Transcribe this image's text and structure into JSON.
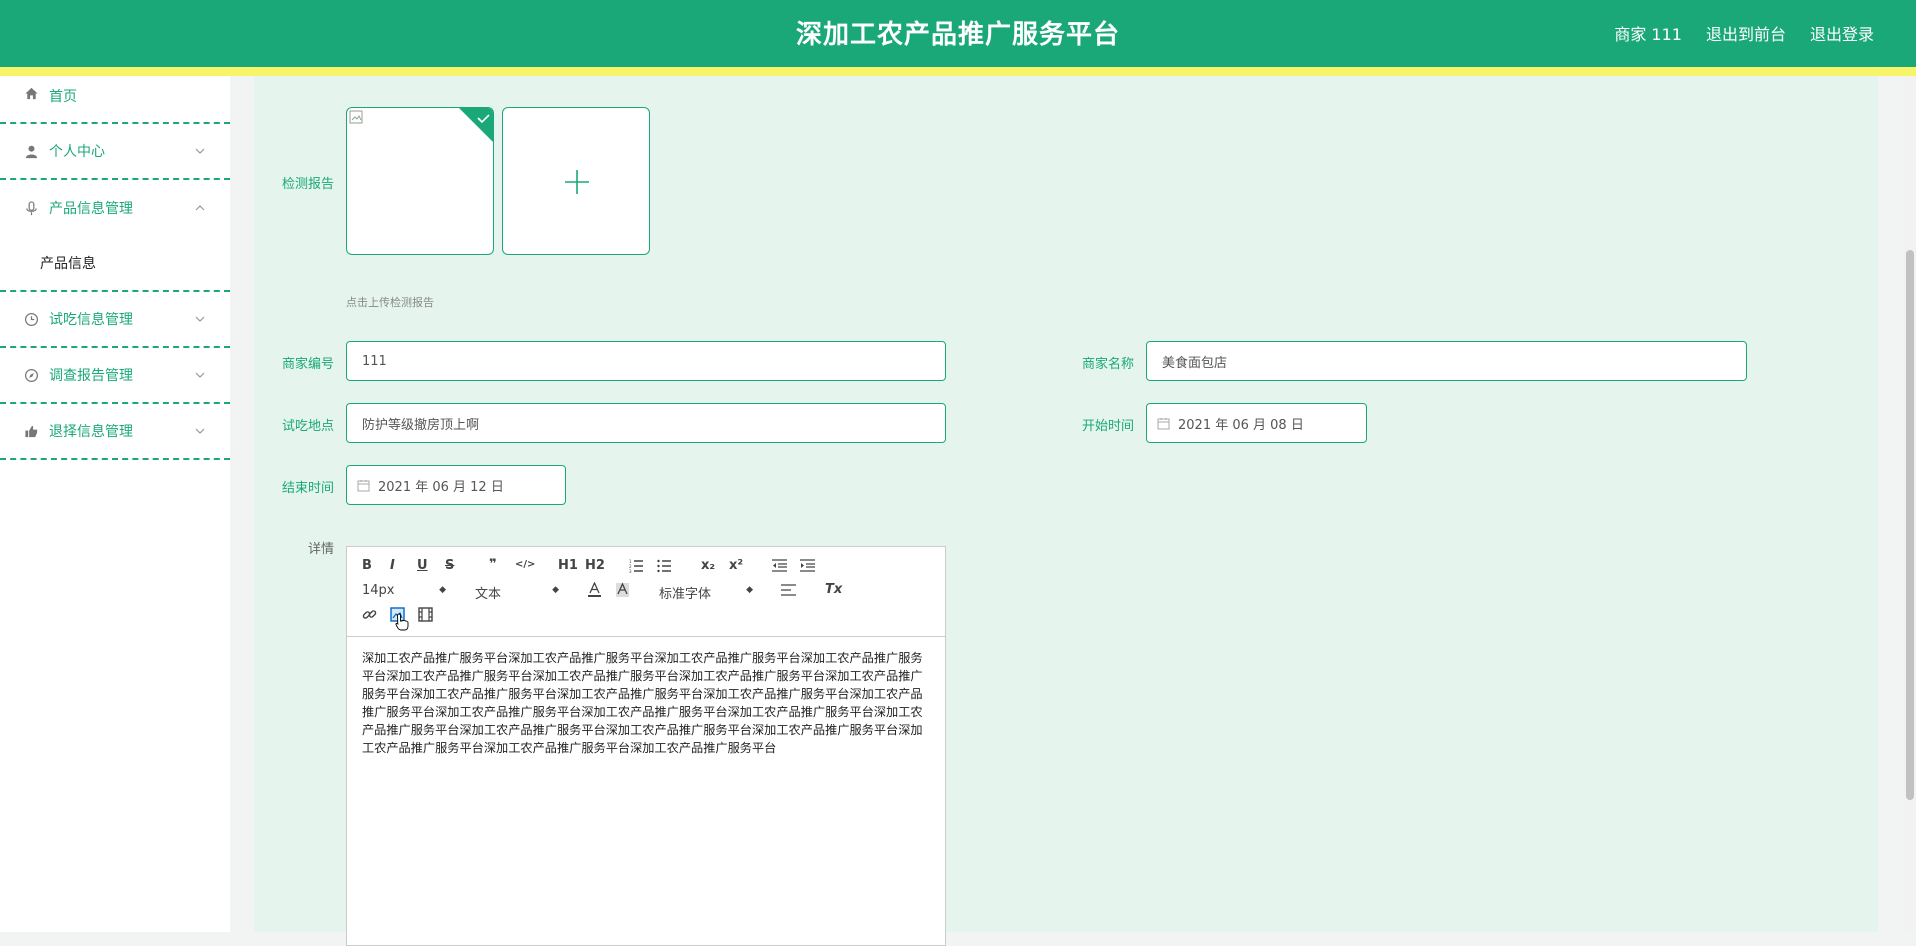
{
  "header": {
    "title": "深加工农产品推广服务平台",
    "links": [
      "商家 111",
      "退出到前台",
      "退出登录"
    ]
  },
  "sidebar": {
    "items": [
      {
        "label": "首页",
        "icon": "home-icon"
      },
      {
        "label": "个人中心",
        "icon": "user-icon"
      },
      {
        "label": "产品信息管理",
        "icon": "mic-icon",
        "expanded": true,
        "children": [
          "产品信息"
        ]
      },
      {
        "label": "试吃信息管理",
        "icon": "clock-icon"
      },
      {
        "label": "调查报告管理",
        "icon": "compass-icon"
      },
      {
        "label": "退择信息管理",
        "icon": "thumb-icon"
      }
    ]
  },
  "form": {
    "report_label": "检测报告",
    "upload_tip": "点击上传检测报告",
    "merchant_no_label": "商家编号",
    "merchant_no_value": "111",
    "merchant_name_label": "商家名称",
    "merchant_name_value": "美食面包店",
    "place_label": "试吃地点",
    "place_value": "防护等级撤房顶上啊",
    "start_label": "开始时间",
    "start_value": "2021 年 06 月 08 日",
    "end_label": "结束时间",
    "end_value": "2021 年 06 月 12 日",
    "detail_label": "详情"
  },
  "editor": {
    "toolbar": {
      "bold": "B",
      "italic": "I",
      "underline": "U",
      "strike": "S",
      "quote": "❞",
      "code": "</>",
      "h1": "H1",
      "h2": "H2",
      "sub": "x₂",
      "sup": "x²",
      "clean": "Tx",
      "size": "14px",
      "header": "文本",
      "font": "标准字体"
    },
    "content": "深加工农产品推广服务平台深加工农产品推广服务平台深加工农产品推广服务平台深加工农产品推广服务平台深加工农产品推广服务平台深加工农产品推广服务平台深加工农产品推广服务平台深加工农产品推广服务平台深加工农产品推广服务平台深加工农产品推广服务平台深加工农产品推广服务平台深加工农产品推广服务平台深加工农产品推广服务平台深加工农产品推广服务平台深加工农产品推广服务平台深加工农产品推广服务平台深加工农产品推广服务平台深加工农产品推广服务平台深加工农产品推广服务平台深加工农产品推广服务平台深加工农产品推广服务平台深加工农产品推广服务平台"
  },
  "colors": {
    "primary": "#1aa879",
    "stripe": "#f7f46a",
    "main_bg": "#e5f5ee"
  }
}
